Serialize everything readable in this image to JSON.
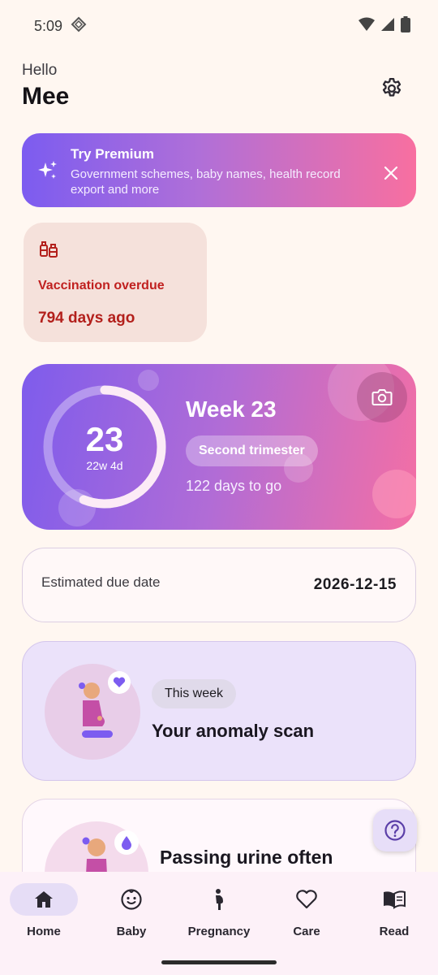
{
  "status_bar": {
    "time": "5:09"
  },
  "header": {
    "hello": "Hello",
    "name": "Mee"
  },
  "premium": {
    "title": "Try Premium",
    "subtitle": "Government schemes, baby names, health record export and more"
  },
  "vaccination": {
    "title": "Vaccination overdue",
    "days": "794 days ago"
  },
  "week_card": {
    "week_number": "23",
    "week_detail": "22w 4d",
    "title": "Week 23",
    "trimester": "Second trimester",
    "days_to_go": "122 days to go",
    "progress_fraction": 0.56
  },
  "due_date": {
    "label": "Estimated due date",
    "value": "2026-12-15"
  },
  "scan_card": {
    "pill": "This week",
    "title": "Your anomaly scan"
  },
  "symptom_card": {
    "title": "Passing urine often"
  },
  "nav": {
    "items": [
      {
        "label": "Home",
        "icon": "home-icon",
        "active": true
      },
      {
        "label": "Baby",
        "icon": "baby-face-icon",
        "active": false
      },
      {
        "label": "Pregnancy",
        "icon": "pregnant-person-icon",
        "active": false
      },
      {
        "label": "Care",
        "icon": "heart-icon",
        "active": false
      },
      {
        "label": "Read",
        "icon": "book-icon",
        "active": false
      }
    ]
  },
  "colors": {
    "background": "#FFF7F1",
    "accent_purple": "#7C5CF0",
    "accent_pink": "#F86FA0",
    "alert_red": "#C0201F"
  }
}
